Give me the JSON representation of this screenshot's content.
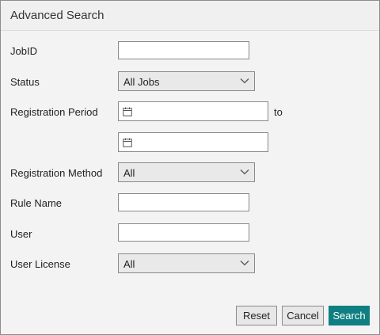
{
  "dialog": {
    "title": "Advanced Search"
  },
  "fields": {
    "jobid": {
      "label": "JobID",
      "value": ""
    },
    "status": {
      "label": "Status",
      "selected": "All Jobs"
    },
    "registration_period": {
      "label": "Registration Period",
      "start": "",
      "end": "",
      "to_label": "to"
    },
    "registration_method": {
      "label": "Registration Method",
      "selected": "All"
    },
    "rule_name": {
      "label": "Rule Name",
      "value": ""
    },
    "user": {
      "label": "User",
      "value": ""
    },
    "user_license": {
      "label": "User License",
      "selected": "All"
    }
  },
  "buttons": {
    "reset": "Reset",
    "cancel": "Cancel",
    "search": "Search"
  },
  "colors": {
    "primary": "#0f7f82",
    "dialog_bg": "#f3f3f3"
  },
  "icons": {
    "date": "calendar-icon",
    "dropdown": "chevron-down-icon"
  }
}
